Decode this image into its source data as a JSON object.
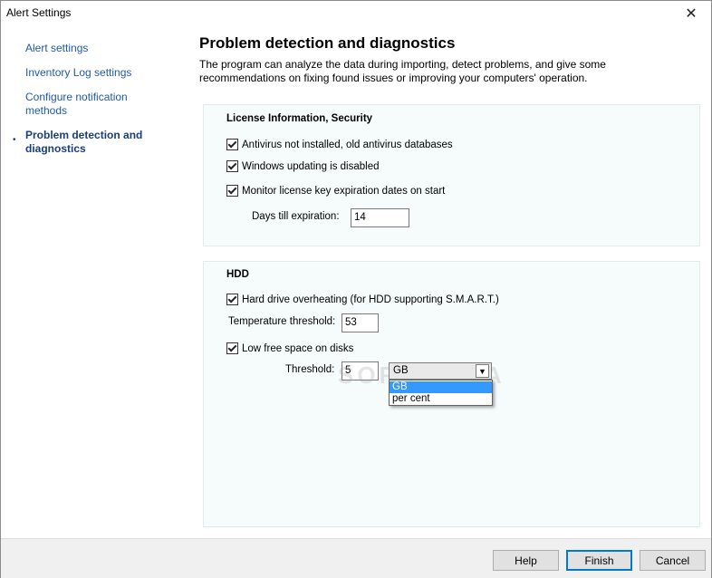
{
  "window": {
    "title": "Alert Settings",
    "close_glyph": "✕"
  },
  "sidebar": {
    "bullet": "•",
    "items": [
      {
        "label": "Alert settings"
      },
      {
        "label": "Inventory Log settings"
      },
      {
        "label": "Configure notification methods"
      },
      {
        "label": "Problem detection and diagnostics"
      }
    ]
  },
  "main": {
    "heading": "Problem detection and diagnostics",
    "description": "The program can analyze the data during importing, detect problems, and give some recommendations on fixing found issues or improving your computers' operation."
  },
  "license_group": {
    "title": "License Information, Security",
    "checks": [
      {
        "label": "Antivirus not installed, old antivirus databases",
        "checked": true
      },
      {
        "label": "Windows updating is disabled",
        "checked": true
      },
      {
        "label": "Monitor license key expiration dates on start",
        "checked": true
      }
    ],
    "days_label": "Days till expiration:",
    "days_value": "14"
  },
  "hdd_group": {
    "title": "HDD",
    "overheat_label": "Hard drive overheating (for HDD supporting S.M.A.R.T.)",
    "overheat_checked": true,
    "temp_label": "Temperature threshold:",
    "temp_value": "53",
    "low_space_label": "Low free space on disks",
    "low_space_checked": true,
    "threshold_label": "Threshold:",
    "threshold_value": "5",
    "unit_selected": "GB",
    "unit_options": [
      "GB",
      "per cent"
    ]
  },
  "watermark": "SOFTPEDIA",
  "footer": {
    "help_label": "Help",
    "finish_label": "Finish",
    "cancel_label": "Cancel"
  },
  "icons": {
    "close": "close-icon",
    "checkmark": "checkmark-icon",
    "dropdown_arrow": "chevron-down-icon"
  },
  "colors": {
    "link": "#1e5aa8",
    "active_link": "#1a3e78",
    "group_bg": "#f6fbfb",
    "selection": "#3399ff",
    "primary_border": "#0078d7"
  }
}
